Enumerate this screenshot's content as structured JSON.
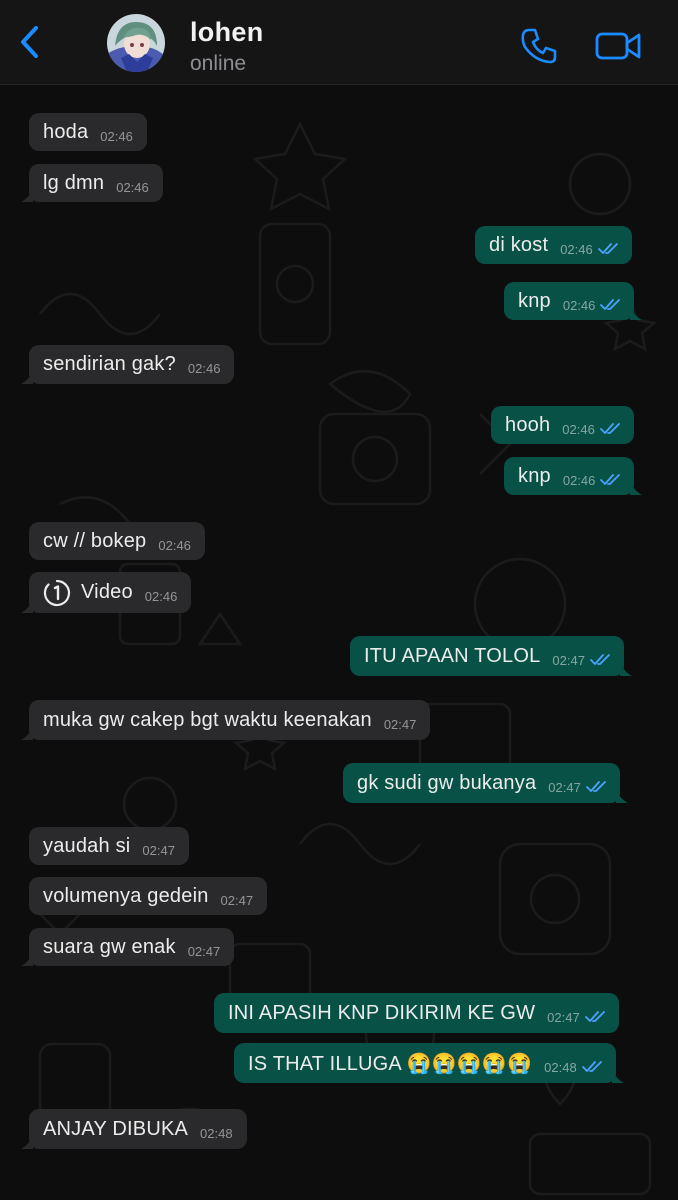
{
  "header": {
    "contact_name": "lohen",
    "contact_status": "online"
  },
  "colors": {
    "accent": "#1a8cff",
    "incoming_bubble": "#2a2a2c",
    "outgoing_bubble": "#075146",
    "read_ticks": "#4aa3ff"
  },
  "messages": [
    {
      "dir": "in",
      "text": "hoda",
      "time": "02:46"
    },
    {
      "dir": "in",
      "text": "lg dmn",
      "time": "02:46"
    },
    {
      "dir": "out",
      "text": "di kost",
      "time": "02:46",
      "status": "read"
    },
    {
      "dir": "out",
      "text": "knp",
      "time": "02:46",
      "status": "read"
    },
    {
      "dir": "in",
      "text": "sendirian gak?",
      "time": "02:46"
    },
    {
      "dir": "out",
      "text": "hooh",
      "time": "02:46",
      "status": "read"
    },
    {
      "dir": "out",
      "text": "knp",
      "time": "02:46",
      "status": "read"
    },
    {
      "dir": "in",
      "text": "cw // bokep",
      "time": "02:46"
    },
    {
      "dir": "in",
      "text": "Video",
      "time": "02:46",
      "icon": "view-once-icon"
    },
    {
      "dir": "out",
      "text": "ITU APAAN TOLOL",
      "time": "02:47",
      "status": "read"
    },
    {
      "dir": "in",
      "text": "muka gw cakep bgt waktu keenakan",
      "time": "02:47"
    },
    {
      "dir": "out",
      "text": "gk sudi gw bukanya",
      "time": "02:47",
      "status": "read"
    },
    {
      "dir": "in",
      "text": "yaudah si",
      "time": "02:47"
    },
    {
      "dir": "in",
      "text": "volumenya gedein",
      "time": "02:47"
    },
    {
      "dir": "in",
      "text": "suara gw enak",
      "time": "02:47"
    },
    {
      "dir": "out",
      "text": "INI APASIH KNP DIKIRIM KE GW",
      "time": "02:47",
      "status": "read"
    },
    {
      "dir": "out",
      "text": "IS THAT ILLUGA 😭😭😭😭😭",
      "time": "02:48",
      "status": "read"
    },
    {
      "dir": "in",
      "text": "ANJAY DIBUKA",
      "time": "02:48"
    }
  ]
}
